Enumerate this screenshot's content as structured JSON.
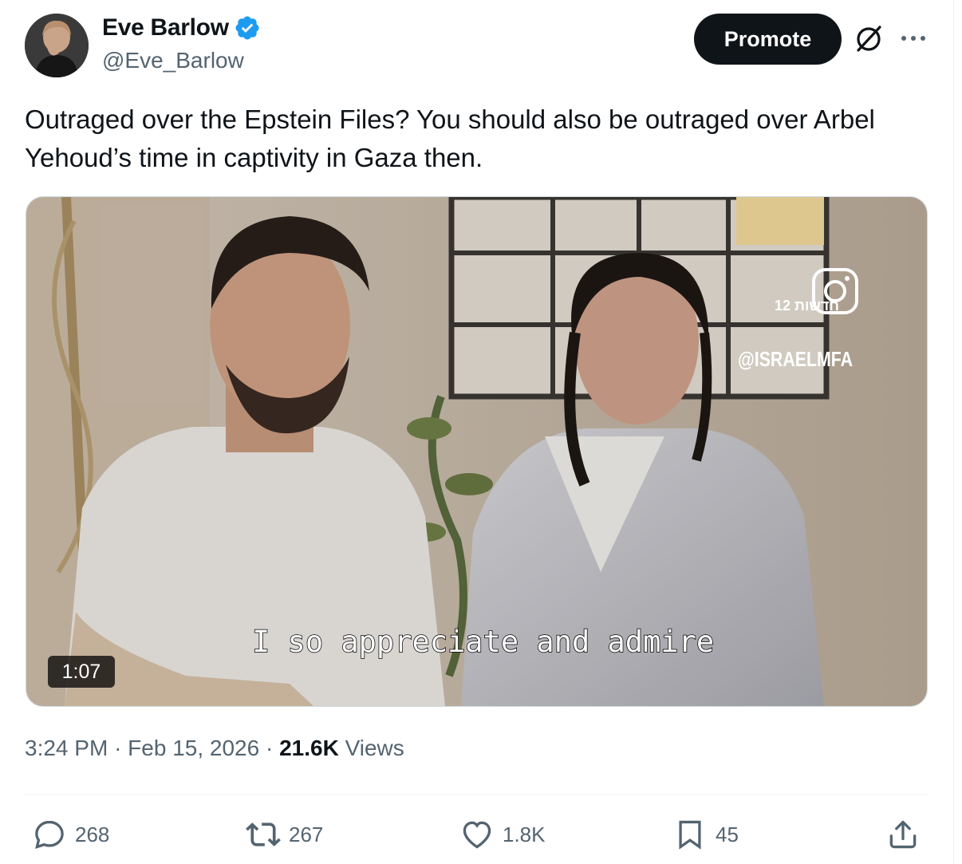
{
  "author": {
    "name": "Eve Barlow",
    "handle": "@Eve_Barlow",
    "verified_icon": "verified-badge-icon"
  },
  "header": {
    "promote_label": "Promote",
    "grok_icon": "grok-icon",
    "more_icon": "more-options-icon"
  },
  "tweet": {
    "text": "Outraged over the Epstein Files? You should also be outraged over Arbel Yehoud’s time in captivity in Gaza then."
  },
  "video": {
    "duration": "1:07",
    "subtitle": "I so appreciate and admire",
    "watermark_handle": "@ISRAELMFA",
    "watermark_channel": "12 חדשות"
  },
  "meta": {
    "time": "3:24 PM",
    "sep1": "·",
    "date": "Feb 15, 2026",
    "sep2": "·",
    "views_count": "21.6K",
    "views_label": "Views"
  },
  "actions": {
    "replies": "268",
    "reposts": "267",
    "likes": "1.8K",
    "bookmarks": "45"
  },
  "colors": {
    "text": "#0f1419",
    "secondary": "#536471",
    "verified": "#1d9bf0",
    "button_bg": "#0f1419"
  }
}
